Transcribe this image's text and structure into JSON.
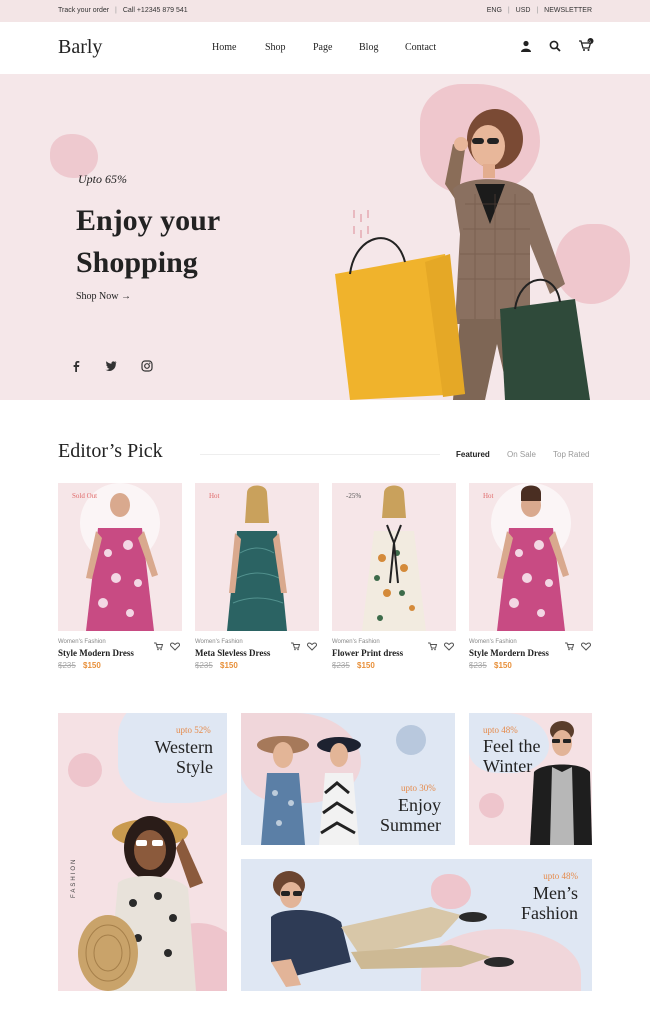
{
  "topbar": {
    "track": "Track your order",
    "sep": "|",
    "call": "Call +12345 879 541",
    "lang": "ENG",
    "currency": "USD",
    "newsletter": "NEWSLETTER"
  },
  "header": {
    "logo": "Barly",
    "nav": [
      "Home",
      "Shop",
      "Page",
      "Blog",
      "Contact"
    ],
    "cart_count": "0"
  },
  "hero": {
    "badge": "Upto 65%",
    "title_line1": "Enjoy your",
    "title_line2": "Shopping",
    "cta": "Shop Now",
    "cta_arrow": "→"
  },
  "editors_pick": {
    "title": "Editor’s Pick",
    "tabs": [
      "Featured",
      "On Sale",
      "Top Rated"
    ],
    "products": [
      {
        "tag": "Sold Out",
        "category": "Women's Fashion",
        "name": "Style Modern Dress",
        "old_price": "$235",
        "price": "$150"
      },
      {
        "tag": "Hot",
        "category": "Women's Fashion",
        "name": "Meta Slevless Dress",
        "old_price": "$235",
        "price": "$150"
      },
      {
        "tag": "-25%",
        "category": "Women's Fashion",
        "name": "Flower Print dress",
        "old_price": "$235",
        "price": "$150"
      },
      {
        "tag": "Hot",
        "category": "Women's Fashion",
        "name": "Style Mordern Dress",
        "old_price": "$235",
        "price": "$150"
      }
    ]
  },
  "banners": {
    "western": {
      "upto": "upto 52%",
      "line1": "Western",
      "line2": "Style",
      "side": "FASHION"
    },
    "summer": {
      "upto": "upto 30%",
      "line1": "Enjoy",
      "line2": "Summer"
    },
    "winter": {
      "upto": "upto 48%",
      "line1": "Feel the",
      "line2": "Winter"
    },
    "men": {
      "upto": "upto 48%",
      "line1": "Men’s",
      "line2": "Fashion"
    }
  },
  "colors": {
    "pink_bg": "#f5e7e9",
    "blue_bg": "#dfe7f3",
    "accent_orange": "#e8903a",
    "tag_red": "#e06a6a"
  }
}
